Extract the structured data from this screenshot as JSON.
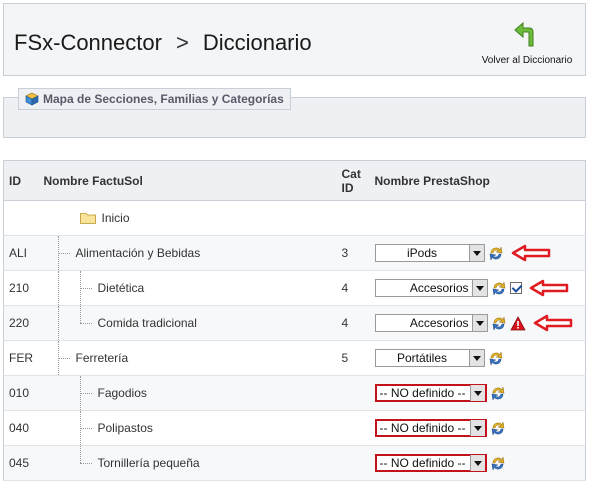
{
  "header": {
    "crumb1": "FSx-Connector",
    "separator": ">",
    "crumb2": "Diccionario",
    "back_label": "Volver al Diccionario"
  },
  "section": {
    "legend": "Mapa de Secciones, Familias y Categorías"
  },
  "table": {
    "col_id": "ID",
    "col_name": "Nombre FactuSol",
    "col_cat": "Cat ID",
    "col_ps": "Nombre PrestaShop",
    "root": "Inicio",
    "rows": [
      {
        "id": "ALI",
        "name": "Alimentación y Bebidas",
        "cat": "3",
        "ps": "iPods"
      },
      {
        "id": "210",
        "name": "Dietética",
        "cat": "4",
        "ps": "Accesorios"
      },
      {
        "id": "220",
        "name": "Comida tradicional",
        "cat": "4",
        "ps": "Accesorios"
      },
      {
        "id": "FER",
        "name": "Ferretería",
        "cat": "5",
        "ps": "Portátiles"
      },
      {
        "id": "010",
        "name": "Fagodios",
        "cat": "",
        "ps": "-- NO definido --"
      },
      {
        "id": "040",
        "name": "Polipastos",
        "cat": "",
        "ps": "-- NO definido --"
      },
      {
        "id": "045",
        "name": "Tornillería pequeña",
        "cat": "",
        "ps": "-- NO definido --"
      }
    ]
  },
  "colors": {
    "undefined_border": "#c4121c",
    "arrow": "#e01b22"
  }
}
